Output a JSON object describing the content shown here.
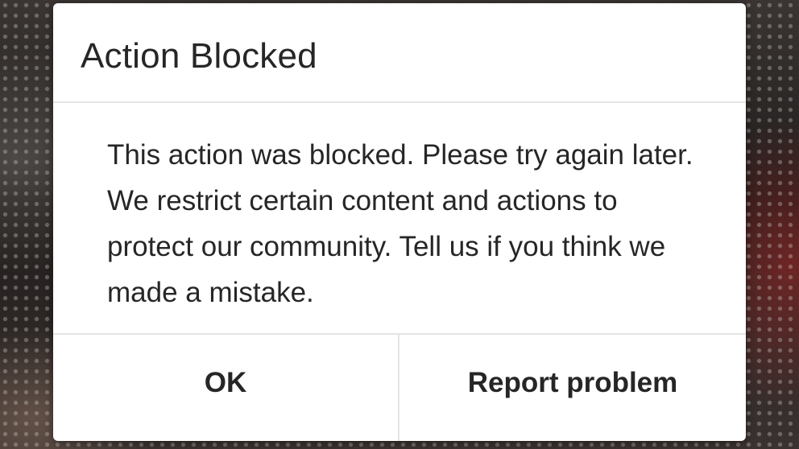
{
  "dialog": {
    "title": "Action Blocked",
    "message": "This action was blocked. Please try again later. We restrict certain content and actions to protect our community. Tell us if you think we made a mistake.",
    "buttons": {
      "ok_label": "OK",
      "report_label": "Report problem"
    }
  },
  "colors": {
    "dialog_background": "#ffffff",
    "text": "#262626",
    "divider": "#e4e4e4"
  }
}
